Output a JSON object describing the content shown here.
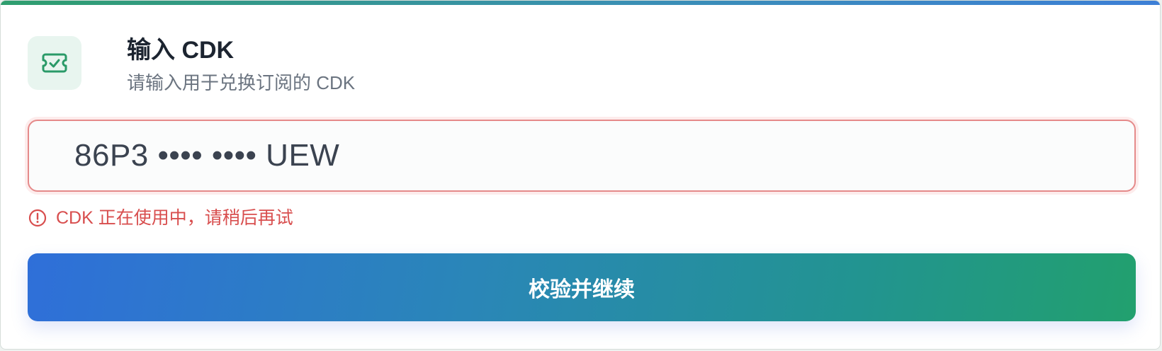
{
  "header": {
    "title": "输入 CDK",
    "subtitle": "请输入用于兑换订阅的 CDK",
    "icon": "ticket-check-icon"
  },
  "cdk_field": {
    "value": "86P3 •••• •••• UEW",
    "state": "error"
  },
  "error": {
    "icon": "alert-circle-icon",
    "message": "CDK 正在使用中，请稍后再试"
  },
  "submit": {
    "label": "校验并继续"
  },
  "colors": {
    "accent_green": "#22a06e",
    "accent_blue": "#2f6fd9",
    "error_red": "#d84e4e",
    "error_border": "#e58a8a",
    "icon_bg": "#e8f5ef"
  }
}
